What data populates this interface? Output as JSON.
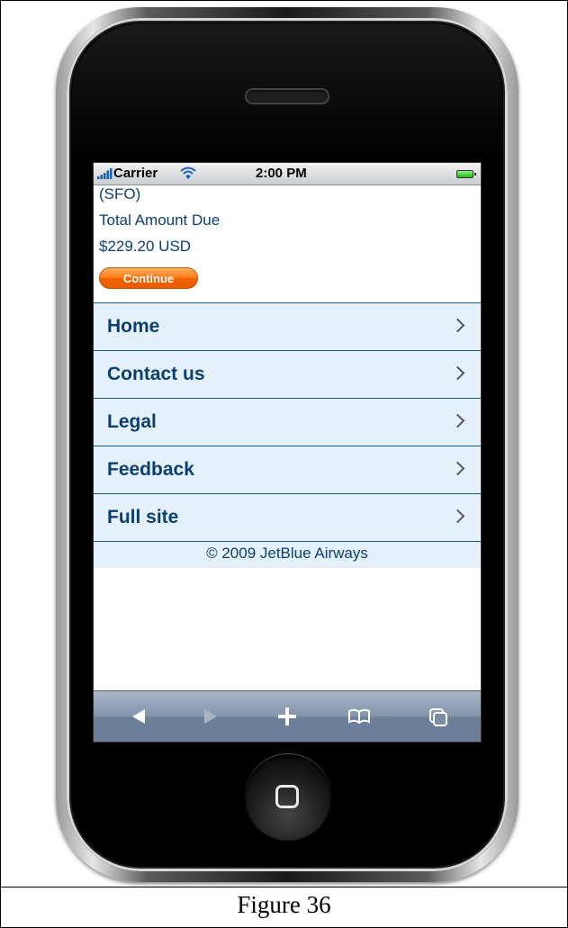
{
  "status_bar": {
    "carrier": "Carrier",
    "time": "2:00 PM"
  },
  "content": {
    "lines": [
      "(SFO)",
      "Total Amount Due",
      "$229.20 USD"
    ],
    "continue_label": "Continue"
  },
  "menu": {
    "items": [
      {
        "label": "Home"
      },
      {
        "label": "Contact us"
      },
      {
        "label": "Legal"
      },
      {
        "label": "Feedback"
      },
      {
        "label": "Full site"
      }
    ],
    "copyright": "© 2009 JetBlue Airways"
  },
  "toolbar": {
    "icons": [
      "back-icon",
      "forward-icon",
      "add-bookmark-icon",
      "bookmarks-icon",
      "pages-icon"
    ]
  },
  "colors": {
    "link": "#0c3f6e",
    "menu_bg": "#e4f1fa",
    "button_orange": "#ff7a11"
  },
  "caption": "Figure 36"
}
